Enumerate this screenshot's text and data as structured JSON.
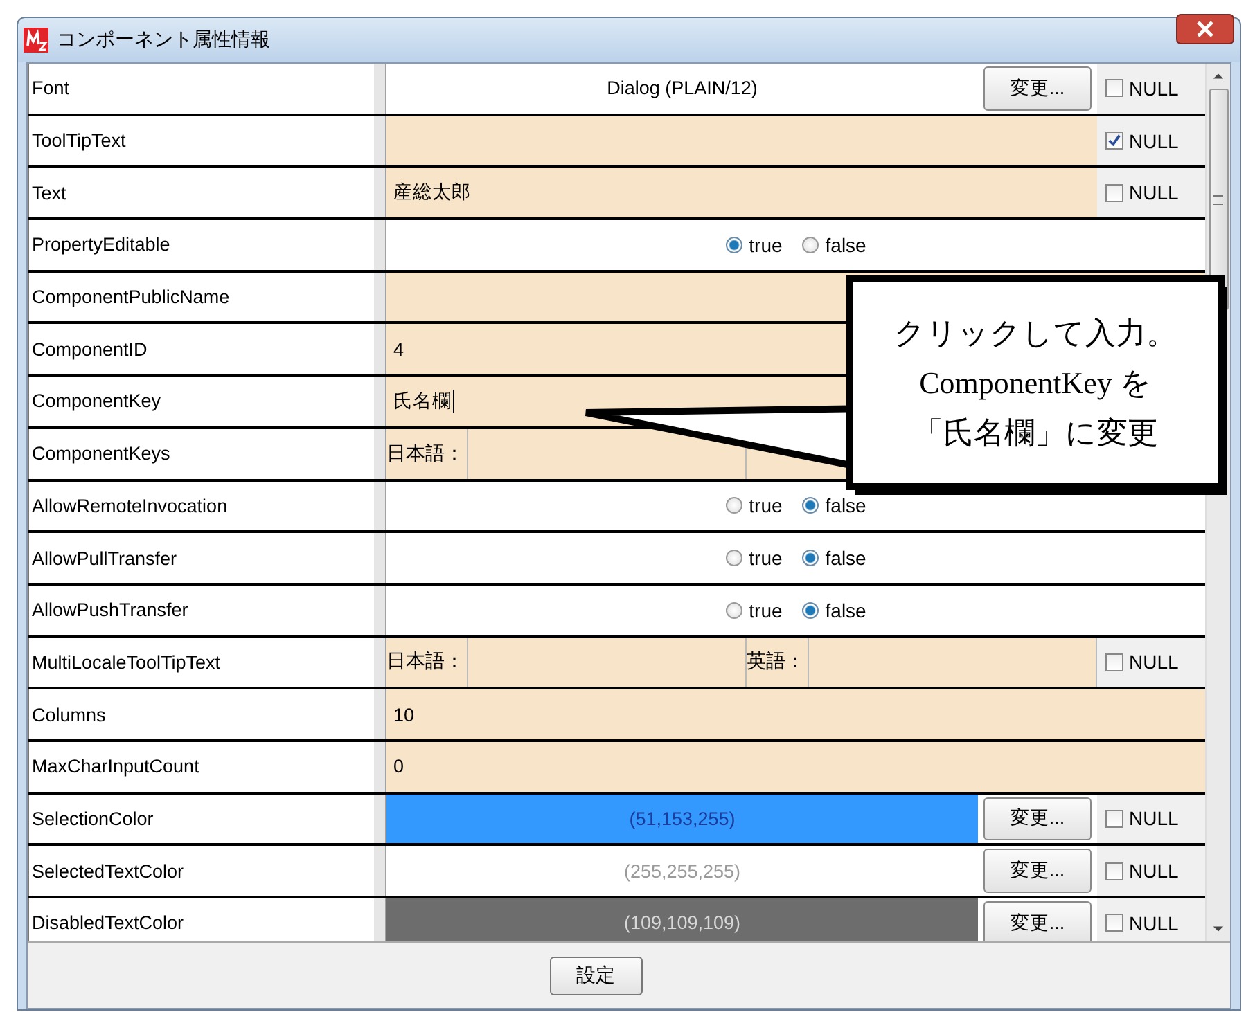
{
  "window": {
    "title": "コンポーネント属性情報"
  },
  "rows": [
    {
      "name": "Font",
      "kind": "button",
      "value": "Dialog (PLAIN/12)",
      "color": "#ffffff",
      "button": "変更...",
      "null_label": "NULL",
      "null_checked": false
    },
    {
      "name": "ToolTipText",
      "kind": "text",
      "null_label": "NULL",
      "null_checked": true
    },
    {
      "name": "Text",
      "kind": "text",
      "value": "産総太郎",
      "null_label": "NULL",
      "null_checked": false
    },
    {
      "name": "PropertyEditable",
      "kind": "radio",
      "options": [
        {
          "label": "true",
          "selected": true
        },
        {
          "label": "false",
          "selected": false
        }
      ]
    },
    {
      "name": "ComponentPublicName",
      "kind": "text"
    },
    {
      "name": "ComponentID",
      "kind": "text",
      "value": "4"
    },
    {
      "name": "ComponentKey",
      "kind": "text",
      "value": "氏名欄",
      "focused": true
    },
    {
      "name": "ComponentKeys",
      "kind": "locale",
      "ja_label": "日本語："
    },
    {
      "name": "AllowRemoteInvocation",
      "kind": "radio",
      "options": [
        {
          "label": "true",
          "selected": false
        },
        {
          "label": "false",
          "selected": true
        }
      ]
    },
    {
      "name": "AllowPullTransfer",
      "kind": "radio",
      "options": [
        {
          "label": "true",
          "selected": false
        },
        {
          "label": "false",
          "selected": true
        }
      ]
    },
    {
      "name": "AllowPushTransfer",
      "kind": "radio",
      "options": [
        {
          "label": "true",
          "selected": false
        },
        {
          "label": "false",
          "selected": true
        }
      ]
    },
    {
      "name": "MultiLocaleToolTipText",
      "kind": "locale",
      "ja_label": "日本語：",
      "en_label": "英語：",
      "null_label": "NULL",
      "null_checked": false
    },
    {
      "name": "Columns",
      "kind": "text",
      "value": "10"
    },
    {
      "name": "MaxCharInputCount",
      "kind": "text",
      "value": "0"
    },
    {
      "name": "SelectionColor",
      "kind": "button",
      "value": "(51,153,255)",
      "color": "#3399ff",
      "button": "変更...",
      "null_label": "NULL",
      "null_checked": false
    },
    {
      "name": "SelectedTextColor",
      "kind": "button",
      "value": "(255,255,255)",
      "color": "#ffffff",
      "button": "変更...",
      "null_label": "NULL",
      "null_checked": false
    },
    {
      "name": "DisabledTextColor",
      "kind": "button",
      "value": "(109,109,109)",
      "color": "#6d6d6d",
      "button": "変更...",
      "null_label": "NULL",
      "null_checked": false
    }
  ],
  "callout": {
    "lines": [
      "クリックして入力。",
      "ComponentKey を",
      "「氏名欄」に変更"
    ]
  },
  "footer": {
    "button": "設定"
  }
}
